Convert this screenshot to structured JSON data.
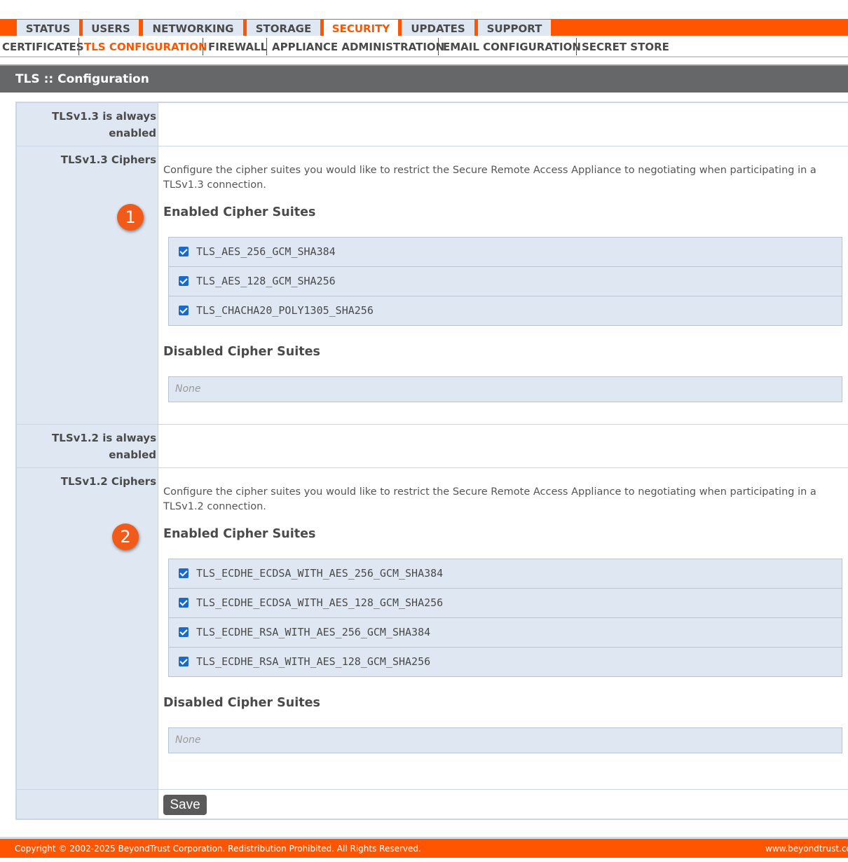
{
  "topnav": {
    "tabs": [
      {
        "label": "STATUS"
      },
      {
        "label": "USERS"
      },
      {
        "label": "NETWORKING"
      },
      {
        "label": "STORAGE"
      },
      {
        "label": "SECURITY"
      },
      {
        "label": "UPDATES"
      },
      {
        "label": "SUPPORT"
      }
    ],
    "active": "SECURITY"
  },
  "subnav": {
    "items": [
      {
        "label": "CERTIFICATES"
      },
      {
        "label": "TLS CONFIGURATION"
      },
      {
        "label": "FIREWALL"
      },
      {
        "label": "APPLIANCE ADMINISTRATION"
      },
      {
        "label": "EMAIL CONFIGURATION"
      },
      {
        "label": "SECRET STORE"
      }
    ],
    "active": "TLS CONFIGURATION"
  },
  "page": {
    "title": "TLS :: Configuration"
  },
  "tls13": {
    "always_label_1": "TLSv1.3 is always",
    "always_label_2": "enabled",
    "ciphers_label": "TLSv1.3 Ciphers",
    "description": "Configure the cipher suites you would like to restrict the Secure Remote Access Appliance to negotiating when participating in a TLSv1.3 connection.",
    "enabled_heading": "Enabled Cipher Suites",
    "enabled": [
      {
        "name": "TLS_AES_256_GCM_SHA384",
        "checked": true
      },
      {
        "name": "TLS_AES_128_GCM_SHA256",
        "checked": true
      },
      {
        "name": "TLS_CHACHA20_POLY1305_SHA256",
        "checked": true
      }
    ],
    "disabled_heading": "Disabled Cipher Suites",
    "disabled_placeholder": "None",
    "badge": "1"
  },
  "tls12": {
    "always_label_1": "TLSv1.2 is always",
    "always_label_2": "enabled",
    "ciphers_label": "TLSv1.2 Ciphers",
    "description": "Configure the cipher suites you would like to restrict the Secure Remote Access Appliance to negotiating when participating in a TLSv1.2 connection.",
    "enabled_heading": "Enabled Cipher Suites",
    "enabled": [
      {
        "name": "TLS_ECDHE_ECDSA_WITH_AES_256_GCM_SHA384",
        "checked": true
      },
      {
        "name": "TLS_ECDHE_ECDSA_WITH_AES_128_GCM_SHA256",
        "checked": true
      },
      {
        "name": "TLS_ECDHE_RSA_WITH_AES_256_GCM_SHA384",
        "checked": true
      },
      {
        "name": "TLS_ECDHE_RSA_WITH_AES_128_GCM_SHA256",
        "checked": true
      }
    ],
    "disabled_heading": "Disabled Cipher Suites",
    "disabled_placeholder": "None",
    "badge": "2"
  },
  "save_label": "Save",
  "footer": {
    "copyright": "Copyright © 2002-2025 BeyondTrust Corporation. Redistribution Prohibited. All Rights Reserved.",
    "site": "www.beyondtrust.com"
  },
  "colors": {
    "brand": "#ff5500",
    "header_bg": "#666768",
    "panel_bg": "#dfe7f2",
    "checkbox": "#1a6ac9"
  }
}
